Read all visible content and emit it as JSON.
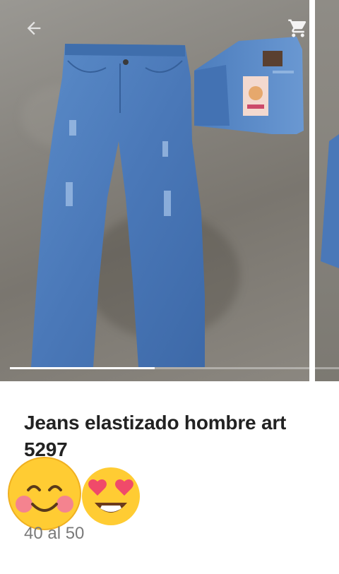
{
  "product": {
    "title": "Jeans elastizado hombre art 5297",
    "subtitle": "40 al 50"
  },
  "carousel": {
    "progress": 0.44,
    "badges": [
      "no-back-jeans-icon"
    ]
  },
  "toolbar": {
    "back_icon": "arrow-left-icon",
    "cart_icon": "shopping-cart-icon"
  },
  "overlay_emojis": [
    "smiling-face-with-blush-icon",
    "smiling-face-with-heart-eyes-icon"
  ],
  "colors": {
    "denim": "#4a78b8",
    "floor": "#86837d",
    "title": "#222222",
    "subtitle": "#7a7a7a"
  }
}
